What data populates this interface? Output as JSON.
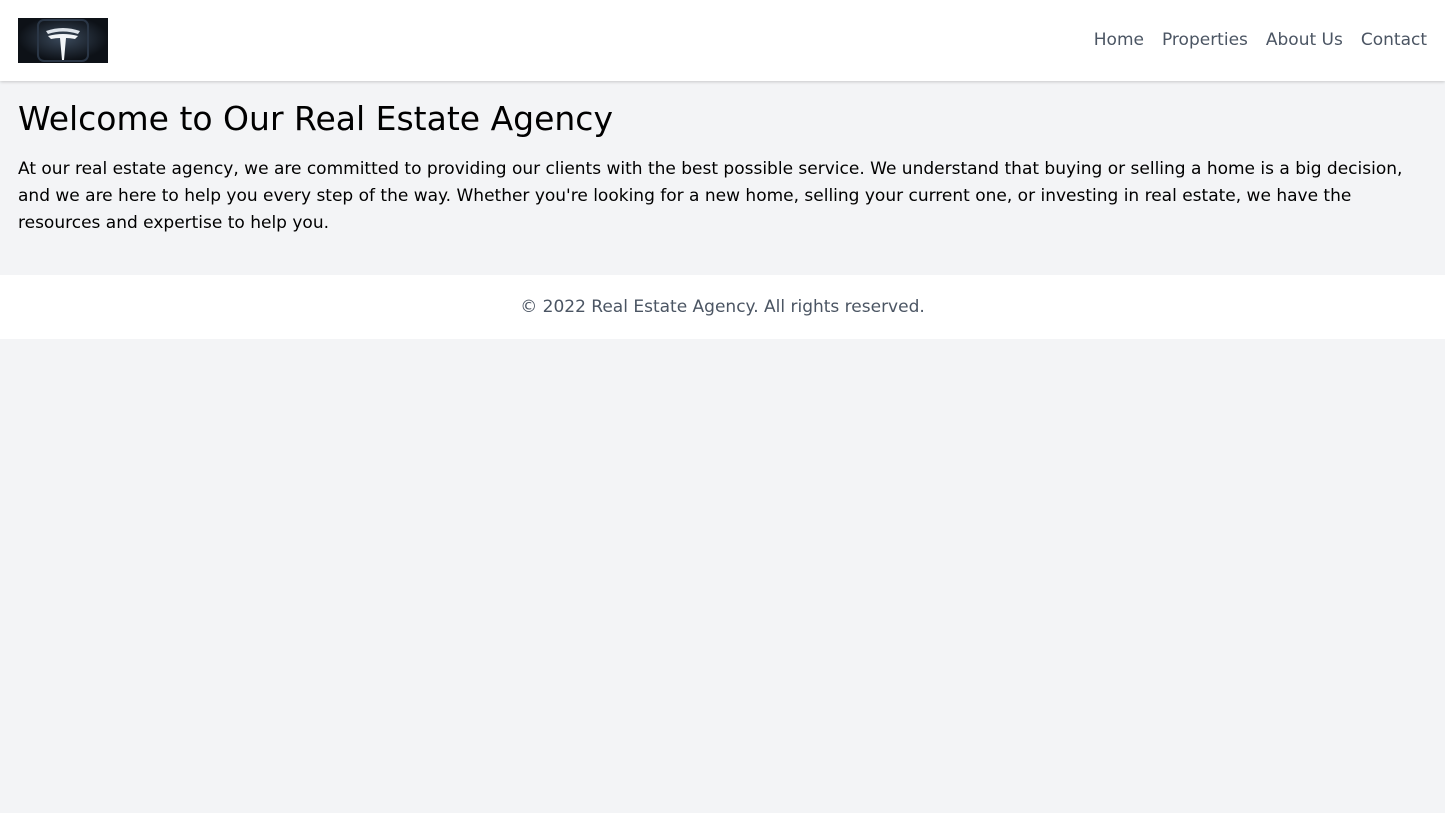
{
  "header": {
    "logo_label": "Tesla logo",
    "nav": [
      {
        "label": "Home"
      },
      {
        "label": "Properties"
      },
      {
        "label": "About Us"
      },
      {
        "label": "Contact"
      }
    ]
  },
  "main": {
    "title": "Welcome to Our Real Estate Agency",
    "intro": "At our real estate agency, we are committed to providing our clients with the best possible service. We understand that buying or selling a home is a big decision, and we are here to help you every step of the way. Whether you're looking for a new home, selling your current one, or investing in real estate, we have the resources and expertise to help you."
  },
  "footer": {
    "copyright": "© 2022 Real Estate Agency. All rights reserved."
  },
  "colors": {
    "page_background": "#f3f4f6",
    "header_background": "#ffffff",
    "nav_text": "#4b5563",
    "footer_text": "#4b5563",
    "logo_background": "#0d1117"
  }
}
